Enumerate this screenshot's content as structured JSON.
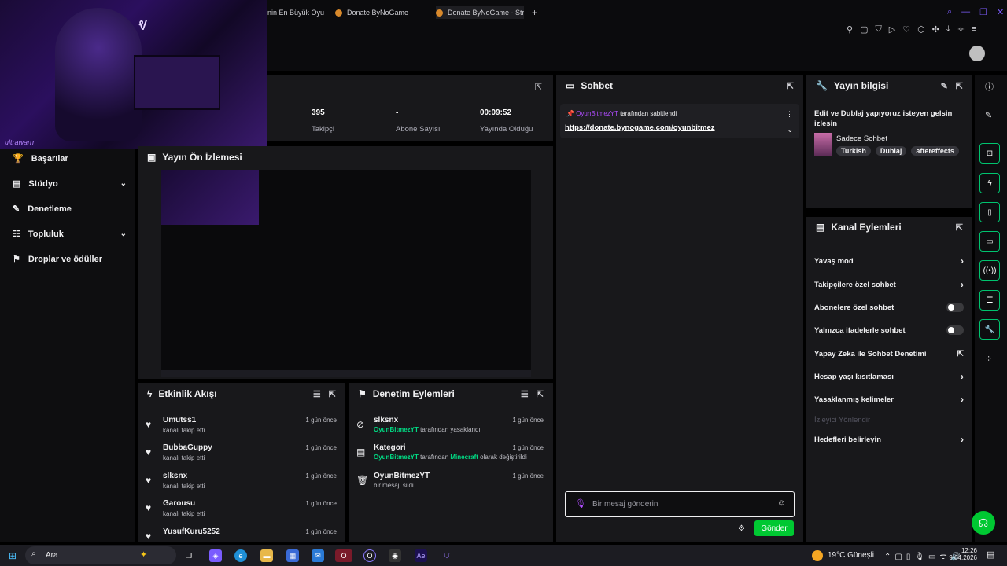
{
  "browser": {
    "tabs": [
      "nin En Büyük Oyu",
      "Donate ByNoGame",
      "Donate ByNoGame - Strea"
    ],
    "new_tab": "+"
  },
  "webcam": {
    "tag": "ultrawarrr"
  },
  "stats": [
    {
      "value": "395",
      "label": "Takipçi"
    },
    {
      "value": "-",
      "label": "Abone Sayısı"
    },
    {
      "value": "00:09:52",
      "label": "Yayında Olduğu Süre"
    }
  ],
  "nav": [
    {
      "label": "Başarılar",
      "icon": "trophy-icon",
      "chevron": false
    },
    {
      "label": "Stüdyo",
      "icon": "studio-icon",
      "chevron": true
    },
    {
      "label": "Denetleme",
      "icon": "wrench-icon",
      "chevron": false
    },
    {
      "label": "Topluluk",
      "icon": "community-icon",
      "chevron": true
    },
    {
      "label": "Droplar ve ödüller",
      "icon": "drops-icon",
      "chevron": false
    }
  ],
  "preview": {
    "title": "Yayın Ön İzlemesi"
  },
  "activity": {
    "title": "Etkinlik Akışı",
    "items": [
      {
        "name": "Umutss1",
        "sub": "kanalı takip etti",
        "time": "1 gün önce"
      },
      {
        "name": "BubbaGuppy",
        "sub": "kanalı takip etti",
        "time": "1 gün önce"
      },
      {
        "name": "slksnx",
        "sub": "kanalı takip etti",
        "time": "1 gün önce"
      },
      {
        "name": "Garousu",
        "sub": "kanalı takip etti",
        "time": "1 gün önce"
      },
      {
        "name": "YusufKuru5252",
        "sub": "",
        "time": "1 gün önce"
      }
    ]
  },
  "modactions": {
    "title": "Denetim Eylemleri",
    "items": [
      {
        "name": "slksnx",
        "actor": "OyunBitmezYT",
        "text": " tarafından yasaklandı",
        "extra": "",
        "extra_tail": "",
        "time": "1 gün önce"
      },
      {
        "name": "Kategori",
        "actor": "OyunBitmezYT",
        "text": " tarafından ",
        "extra": "Minecraft",
        "extra_tail": " olarak değiştirildi",
        "time": "1 gün önce"
      },
      {
        "name": "OyunBitmezYT",
        "actor": "",
        "text": "bir mesajı sildi",
        "extra": "",
        "extra_tail": "",
        "time": "1 gün önce"
      }
    ]
  },
  "chat": {
    "title": "Sohbet",
    "pinned_by": "OyunBitmezYT",
    "pinned_by_suffix": "tarafından sabitlendi",
    "pinned_link": "https://donate.bynogame.com/oyunbitmez",
    "placeholder": "Bir mesaj gönderin",
    "send": "Gönder"
  },
  "streaminfo": {
    "title": "Yayın bilgisi",
    "text": "Edit ve Dublaj yapıyoruz isteyen gelsin izlesin",
    "category": "Sadece Sohbet",
    "tags": [
      "Turkish",
      "Dublaj",
      "aftereffects"
    ]
  },
  "channel_actions": {
    "title": "Kanal Eylemleri",
    "items": [
      {
        "label": "Yavaş mod",
        "kind": "arrow"
      },
      {
        "label": "Takipçilere özel sohbet",
        "kind": "arrow"
      },
      {
        "label": "Abonelere özel sohbet",
        "kind": "toggle"
      },
      {
        "label": "Yalnızca ifadelerle sohbet",
        "kind": "toggle"
      },
      {
        "label": "Yapay Zeka ile Sohbet Denetimi",
        "kind": "ext"
      },
      {
        "label": "Hesap yaşı kısıtlaması",
        "kind": "arrow"
      },
      {
        "label": "Yasaklanmış kelimeler",
        "kind": "arrow"
      },
      {
        "label": "İzleyici Yönlendir",
        "kind": "disabled"
      },
      {
        "label": "Hedefleri belirleyin",
        "kind": "arrow"
      }
    ]
  },
  "taskbar": {
    "search": "Ara",
    "weather": "19°C",
    "weather_desc": "Güneşli",
    "time": "12:26",
    "date": "9.04.2026"
  },
  "colors": {
    "accent": "#00db84",
    "chat_user": "#b04cff",
    "send_btn": "#00c832"
  }
}
